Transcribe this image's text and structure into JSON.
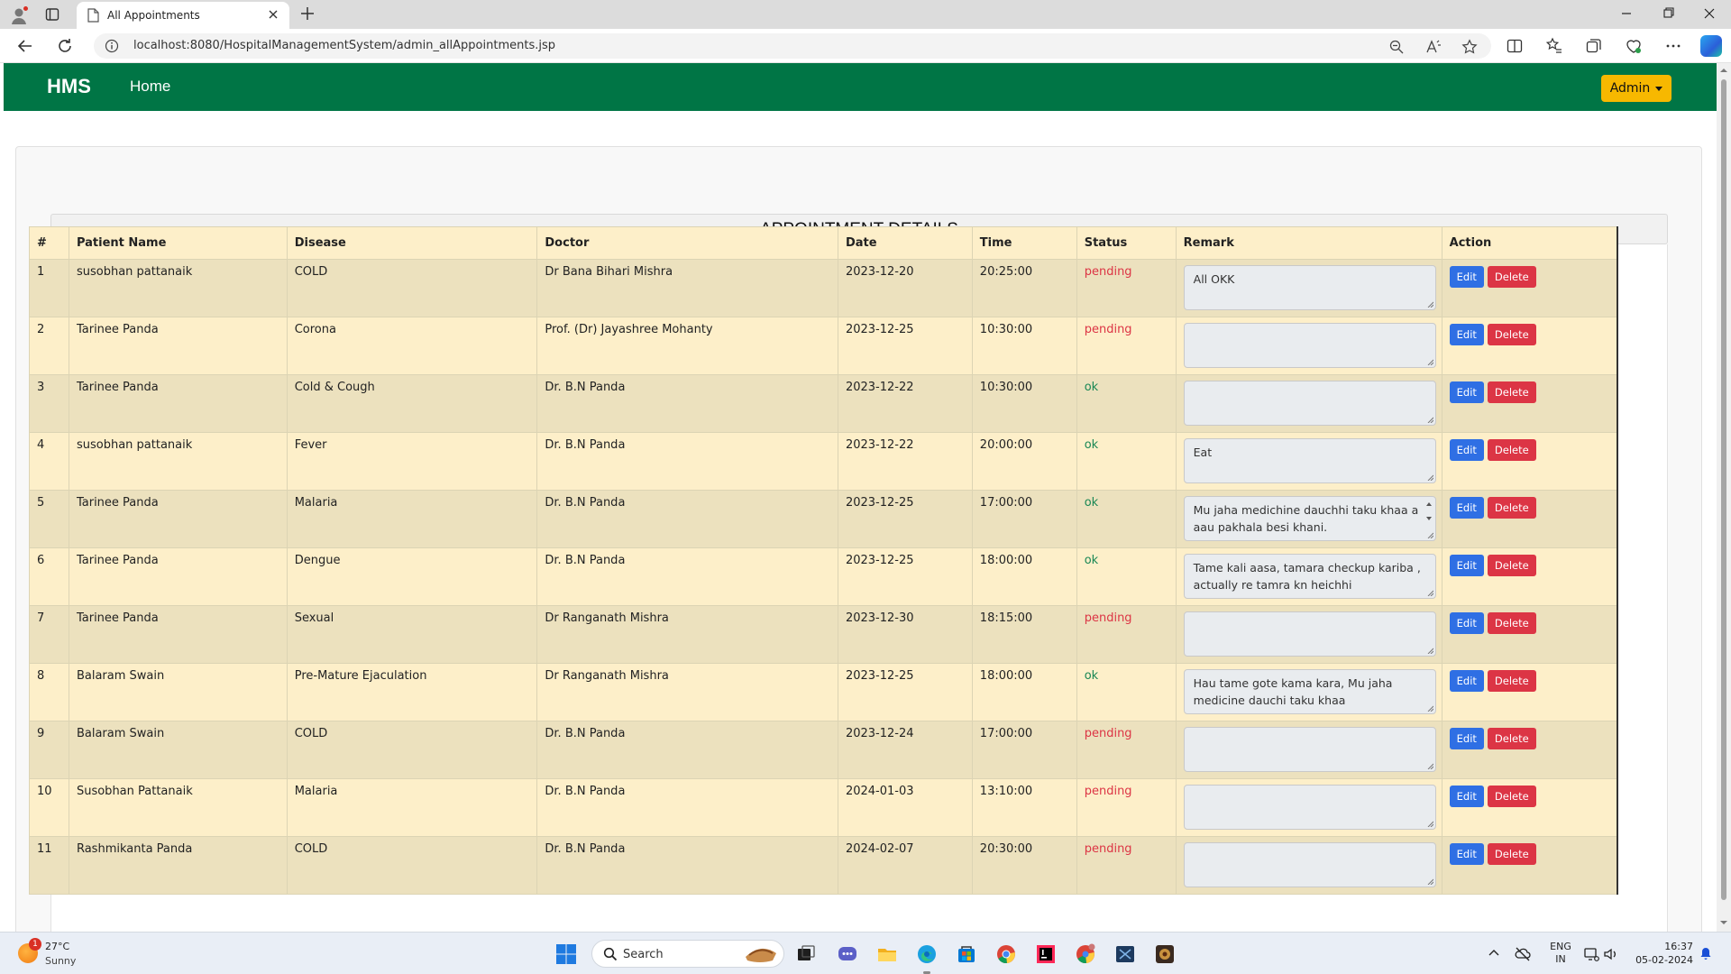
{
  "browser": {
    "tab_title": "All Appointments",
    "url": "localhost:8080/HospitalManagementSystem/admin_allAppointments.jsp"
  },
  "navbar": {
    "brand": "HMS",
    "home_label": "Home",
    "admin_label": "Admin",
    "color": "#007545",
    "admin_color": "#f7b800"
  },
  "page": {
    "title": "APPOINTMENT DETAILS",
    "columns": [
      "#",
      "Patient Name",
      "Disease",
      "Doctor",
      "Date",
      "Time",
      "Status",
      "Remark",
      "Action"
    ],
    "edit_label": "Edit",
    "delete_label": "Delete",
    "rows": [
      {
        "no": "1",
        "patient": "susobhan pattanaik",
        "disease": "COLD",
        "doctor": "Dr Bana Bihari Mishra",
        "date": "2023-12-20",
        "time": "20:25:00",
        "status": "pending",
        "remark": "All OKK"
      },
      {
        "no": "2",
        "patient": "Tarinee Panda",
        "disease": "Corona",
        "doctor": "Prof. (Dr) Jayashree Mohanty",
        "date": "2023-12-25",
        "time": "10:30:00",
        "status": "pending",
        "remark": ""
      },
      {
        "no": "3",
        "patient": "Tarinee Panda",
        "disease": "Cold & Cough",
        "doctor": "Dr. B.N Panda",
        "date": "2023-12-22",
        "time": "10:30:00",
        "status": "ok",
        "remark": ""
      },
      {
        "no": "4",
        "patient": "susobhan pattanaik",
        "disease": "Fever",
        "doctor": "Dr. B.N Panda",
        "date": "2023-12-22",
        "time": "20:00:00",
        "status": "ok",
        "remark": "Eat"
      },
      {
        "no": "5",
        "patient": "Tarinee Panda",
        "disease": "Malaria",
        "doctor": "Dr. B.N Panda",
        "date": "2023-12-25",
        "time": "17:00:00",
        "status": "ok",
        "remark": "Mu jaha medichine dauchhi taku khaa a aau pakhala besi khani."
      },
      {
        "no": "6",
        "patient": "Tarinee Panda",
        "disease": "Dengue",
        "doctor": "Dr. B.N Panda",
        "date": "2023-12-25",
        "time": "18:00:00",
        "status": "ok",
        "remark": "Tame kali aasa, tamara checkup kariba , actually re tamra kn heichhi"
      },
      {
        "no": "7",
        "patient": "Tarinee Panda",
        "disease": "Sexual",
        "doctor": "Dr Ranganath Mishra",
        "date": "2023-12-30",
        "time": "18:15:00",
        "status": "pending",
        "remark": ""
      },
      {
        "no": "8",
        "patient": "Balaram Swain",
        "disease": "Pre-Mature Ejaculation",
        "doctor": "Dr Ranganath Mishra",
        "date": "2023-12-25",
        "time": "18:00:00",
        "status": "ok",
        "remark": "Hau tame gote kama kara, Mu jaha medicine dauchi taku khaa"
      },
      {
        "no": "9",
        "patient": "Balaram Swain",
        "disease": "COLD",
        "doctor": "Dr. B.N Panda",
        "date": "2023-12-24",
        "time": "17:00:00",
        "status": "pending",
        "remark": ""
      },
      {
        "no": "10",
        "patient": "Susobhan Pattanaik",
        "disease": "Malaria",
        "doctor": "Dr. B.N Panda",
        "date": "2024-01-03",
        "time": "13:10:00",
        "status": "pending",
        "remark": ""
      },
      {
        "no": "11",
        "patient": "Rashmikanta Panda",
        "disease": "COLD",
        "doctor": "Dr. B.N Panda",
        "date": "2024-02-07",
        "time": "20:30:00",
        "status": "pending",
        "remark": ""
      }
    ]
  },
  "taskbar": {
    "weather_temp": "27°C",
    "weather_desc": "Sunny",
    "weather_badge": "1",
    "search_label": "Search",
    "lang_1": "ENG",
    "lang_2": "IN",
    "time": "16:37",
    "date": "05-02-2024"
  }
}
